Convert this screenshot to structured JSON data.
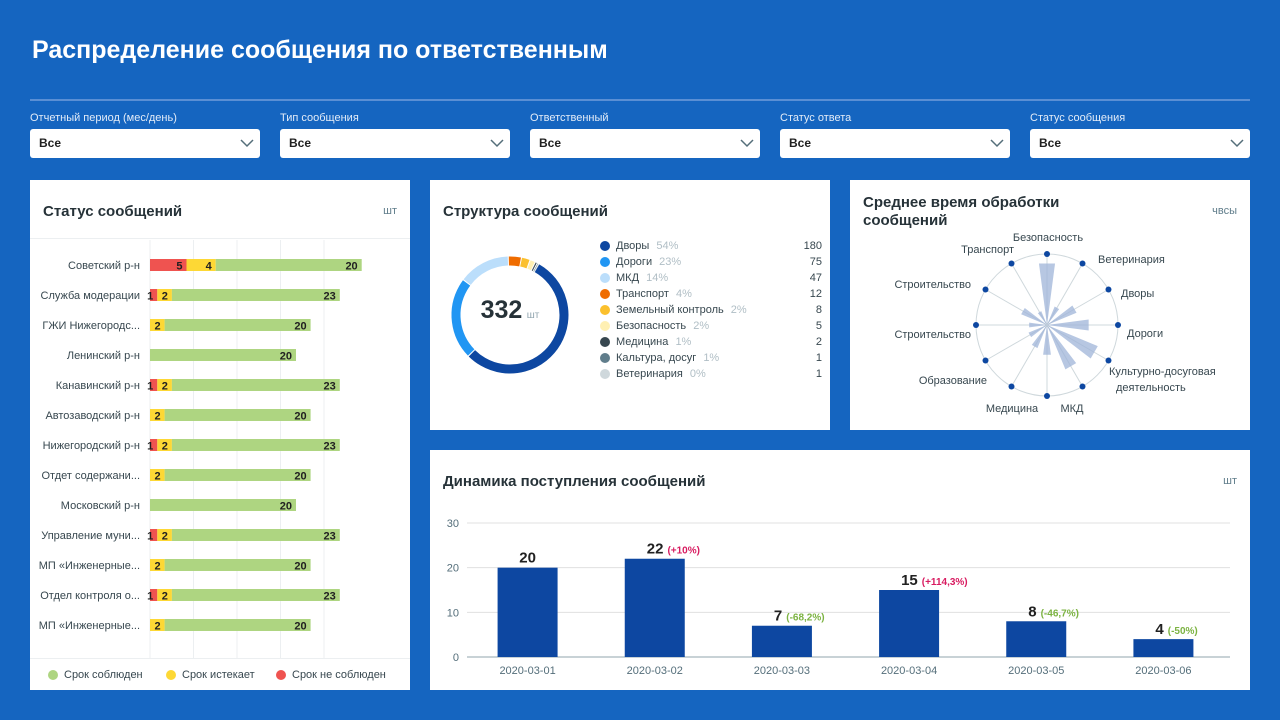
{
  "page": {
    "title": "Распределение сообщения по ответственным"
  },
  "filters": [
    {
      "label": "Отчетный период (мес/день)",
      "value": "Все"
    },
    {
      "label": "Тип сообщения",
      "value": "Все"
    },
    {
      "label": "Ответственный",
      "value": "Все"
    },
    {
      "label": "Статус ответа",
      "value": "Все"
    },
    {
      "label": "Статус сообщения",
      "value": "Все"
    }
  ],
  "status_card": {
    "title": "Статус сообщений",
    "unit": "шт",
    "legend": [
      {
        "label": "Срок соблюден",
        "color": "#aed581"
      },
      {
        "label": "Срок истекает",
        "color": "#fdd835"
      },
      {
        "label": "Срок не соблюден",
        "color": "#ef5350"
      }
    ]
  },
  "structure_card": {
    "title": "Структура сообщений",
    "total": "332",
    "total_unit": "шт",
    "items": [
      {
        "name": "Дворы",
        "pct": "54%",
        "value": "180",
        "color": "#0d47a1"
      },
      {
        "name": "Дороги",
        "pct": "23%",
        "value": "75",
        "color": "#2196f3"
      },
      {
        "name": "МКД",
        "pct": "14%",
        "value": "47",
        "color": "#bbdefb"
      },
      {
        "name": "Транспорт",
        "pct": "4%",
        "value": "12",
        "color": "#ef6c00"
      },
      {
        "name": "Земельный контроль",
        "pct": "2%",
        "value": "8",
        "color": "#fbc02d"
      },
      {
        "name": "Безопасность",
        "pct": "2%",
        "value": "5",
        "color": "#fff0b3"
      },
      {
        "name": "Медицина",
        "pct": "1%",
        "value": "2",
        "color": "#37474f"
      },
      {
        "name": "Кальтура, досуг",
        "pct": "1%",
        "value": "1",
        "color": "#607d8b"
      },
      {
        "name": "Ветеринария",
        "pct": "0%",
        "value": "1",
        "color": "#cfd8dc"
      }
    ]
  },
  "radar_card": {
    "title_line1": "Среднее время обработки",
    "title_line2": "сообщений",
    "unit": "чвсы",
    "labels": {
      "bezopasnost": "Безопасность",
      "veterinaria": "Ветеринария",
      "dvory": "Дворы",
      "dorogi": "Дороги",
      "kultura_line1": "Культурно-досуговая",
      "kultura_line2": "деятельность",
      "mkd": "МКД",
      "medicina": "Медицина",
      "obrazovanie": "Образование",
      "stroitelstvo_1": "Строительство",
      "stroitelstvo_2": "Строительство",
      "transport": "Транспорт"
    }
  },
  "dynamics_card": {
    "title": "Динамика поступления сообщений",
    "unit": "шт"
  },
  "chart_data": [
    {
      "type": "bar",
      "orientation": "horizontal",
      "stacked": true,
      "title": "Статус сообщений",
      "categories": [
        "Советский р-н",
        "Служба модерации",
        "ГЖИ Нижегородс...",
        "Ленинский р-н",
        "Канавинский р-н",
        "Автозаводский р-н",
        "Нижегородский р-н",
        "Отдет содержани...",
        "Московский р-н",
        "Управление муни...",
        "МП «Инженерные...",
        "Отдел контроля о...",
        "МП «Инженерные..."
      ],
      "series": [
        {
          "name": "Срок не соблюден",
          "color": "#ef5350",
          "values": [
            5,
            1,
            0,
            0,
            1,
            0,
            1,
            0,
            0,
            1,
            0,
            1,
            0
          ]
        },
        {
          "name": "Срок истекает",
          "color": "#fdd835",
          "values": [
            4,
            2,
            2,
            0,
            2,
            2,
            2,
            2,
            0,
            2,
            2,
            2,
            2
          ]
        },
        {
          "name": "Срок соблюден",
          "color": "#aed581",
          "values": [
            20,
            23,
            20,
            20,
            23,
            20,
            23,
            20,
            20,
            23,
            20,
            23,
            20
          ]
        }
      ],
      "legend": "bottom"
    },
    {
      "type": "pie",
      "title": "Структура сообщений",
      "total": 332,
      "labels": [
        "Дворы",
        "Дороги",
        "МКД",
        "Транспорт",
        "Земельный контроль",
        "Безопасность",
        "Медицина",
        "Кальтура, досуг",
        "Ветеринария"
      ],
      "values": [
        180,
        75,
        47,
        12,
        8,
        5,
        2,
        1,
        1
      ]
    },
    {
      "type": "bar",
      "title": "Динамика поступления сообщений",
      "categories": [
        "2020-03-01",
        "2020-03-02",
        "2020-03-03",
        "2020-03-04",
        "2020-03-05",
        "2020-03-06"
      ],
      "values": [
        20,
        22,
        7,
        15,
        8,
        4
      ],
      "changes": [
        "",
        "(+10%)",
        "(-68,2%)",
        "(+114,3%)",
        "(-46,7%)",
        "(-50%)"
      ],
      "change_colors": [
        "",
        "#d81b60",
        "#7cb342",
        "#d81b60",
        "#7cb342",
        "#7cb342"
      ],
      "yticks": [
        0,
        10,
        20,
        30
      ],
      "ylim": [
        0,
        30
      ],
      "color": "#0d47a1",
      "grid": true
    }
  ]
}
